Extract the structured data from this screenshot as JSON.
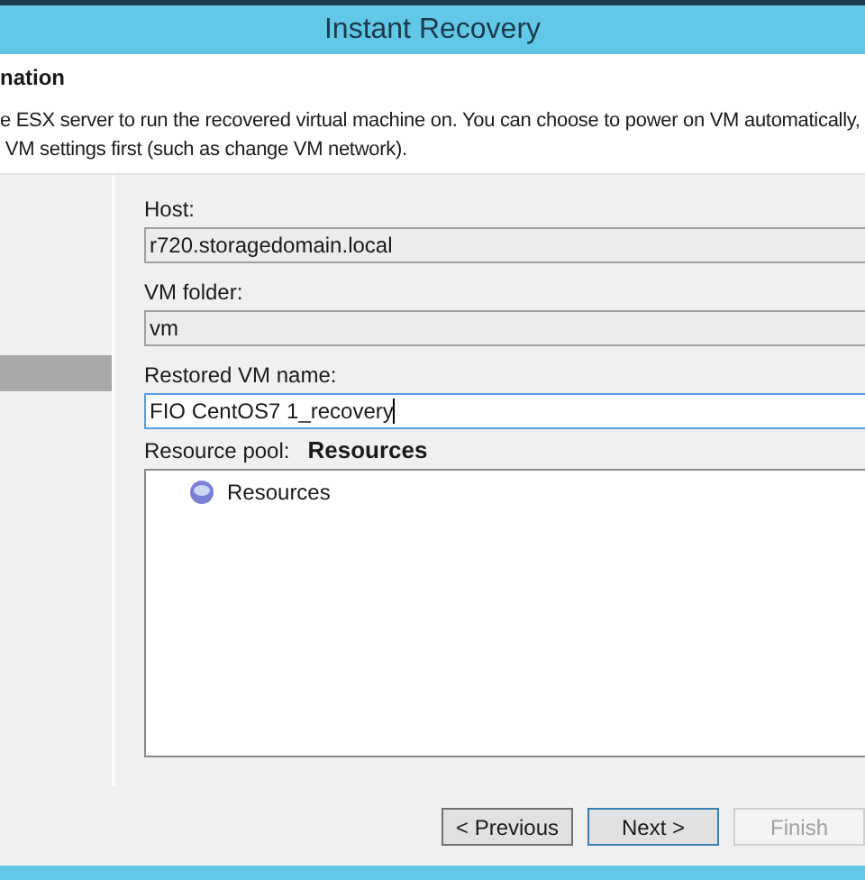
{
  "window": {
    "title": "Instant Recovery"
  },
  "header": {
    "title": "nation",
    "description_lines": [
      "e ESX server to run the recovered virtual machine on. You can choose to power on VM automatically,",
      " VM settings first (such as change VM network)."
    ]
  },
  "fields": [
    {
      "label": "Host:",
      "value": "r720.storagedomain.local",
      "disabled": true,
      "focused": false
    },
    {
      "label": "VM folder:",
      "value": "vm",
      "disabled": true,
      "focused": false
    },
    {
      "label": "Restored VM name:",
      "value": "FIO CentOS7 1_recovery",
      "disabled": false,
      "focused": true
    }
  ],
  "resource_pool": {
    "label": "Resource pool:",
    "value": "Resources",
    "tree": [
      {
        "label": "Resources"
      }
    ]
  },
  "buttons": [
    {
      "label": "< Previous",
      "disabled": false,
      "default": false
    },
    {
      "label": "Next >",
      "disabled": false,
      "default": true
    },
    {
      "label": "Finish",
      "disabled": true,
      "default": false
    }
  ]
}
